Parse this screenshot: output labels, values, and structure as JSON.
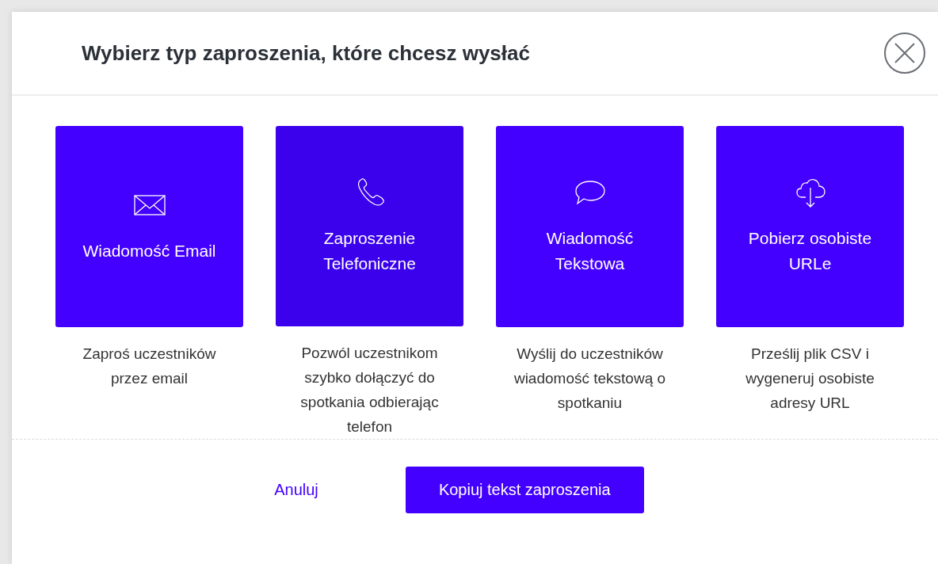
{
  "dialog": {
    "title": "Wybierz typ zaproszenia, które chcesz wysłać"
  },
  "options": [
    {
      "kind": "email",
      "label": "Wiadomość Email",
      "description": "Zaproś uczestników przez email",
      "selected": false
    },
    {
      "kind": "phone",
      "label": "Zaproszenie Telefoniczne",
      "description": "Pozwól uczestnikom szybko dołączyć do spotkania odbierając telefon",
      "selected": true
    },
    {
      "kind": "text",
      "label": "Wiadomość Tekstowa",
      "description": "Wyślij do uczestników wiadomość tekstową o spotkaniu",
      "selected": false
    },
    {
      "kind": "download",
      "label": "Pobierz osobiste URLe",
      "description": "Prześlij plik CSV i wygeneruj osobiste adresy URL",
      "selected": false
    }
  ],
  "buttons": {
    "cancel": "Anuluj",
    "primary": "Kopiuj tekst zaproszenia"
  }
}
